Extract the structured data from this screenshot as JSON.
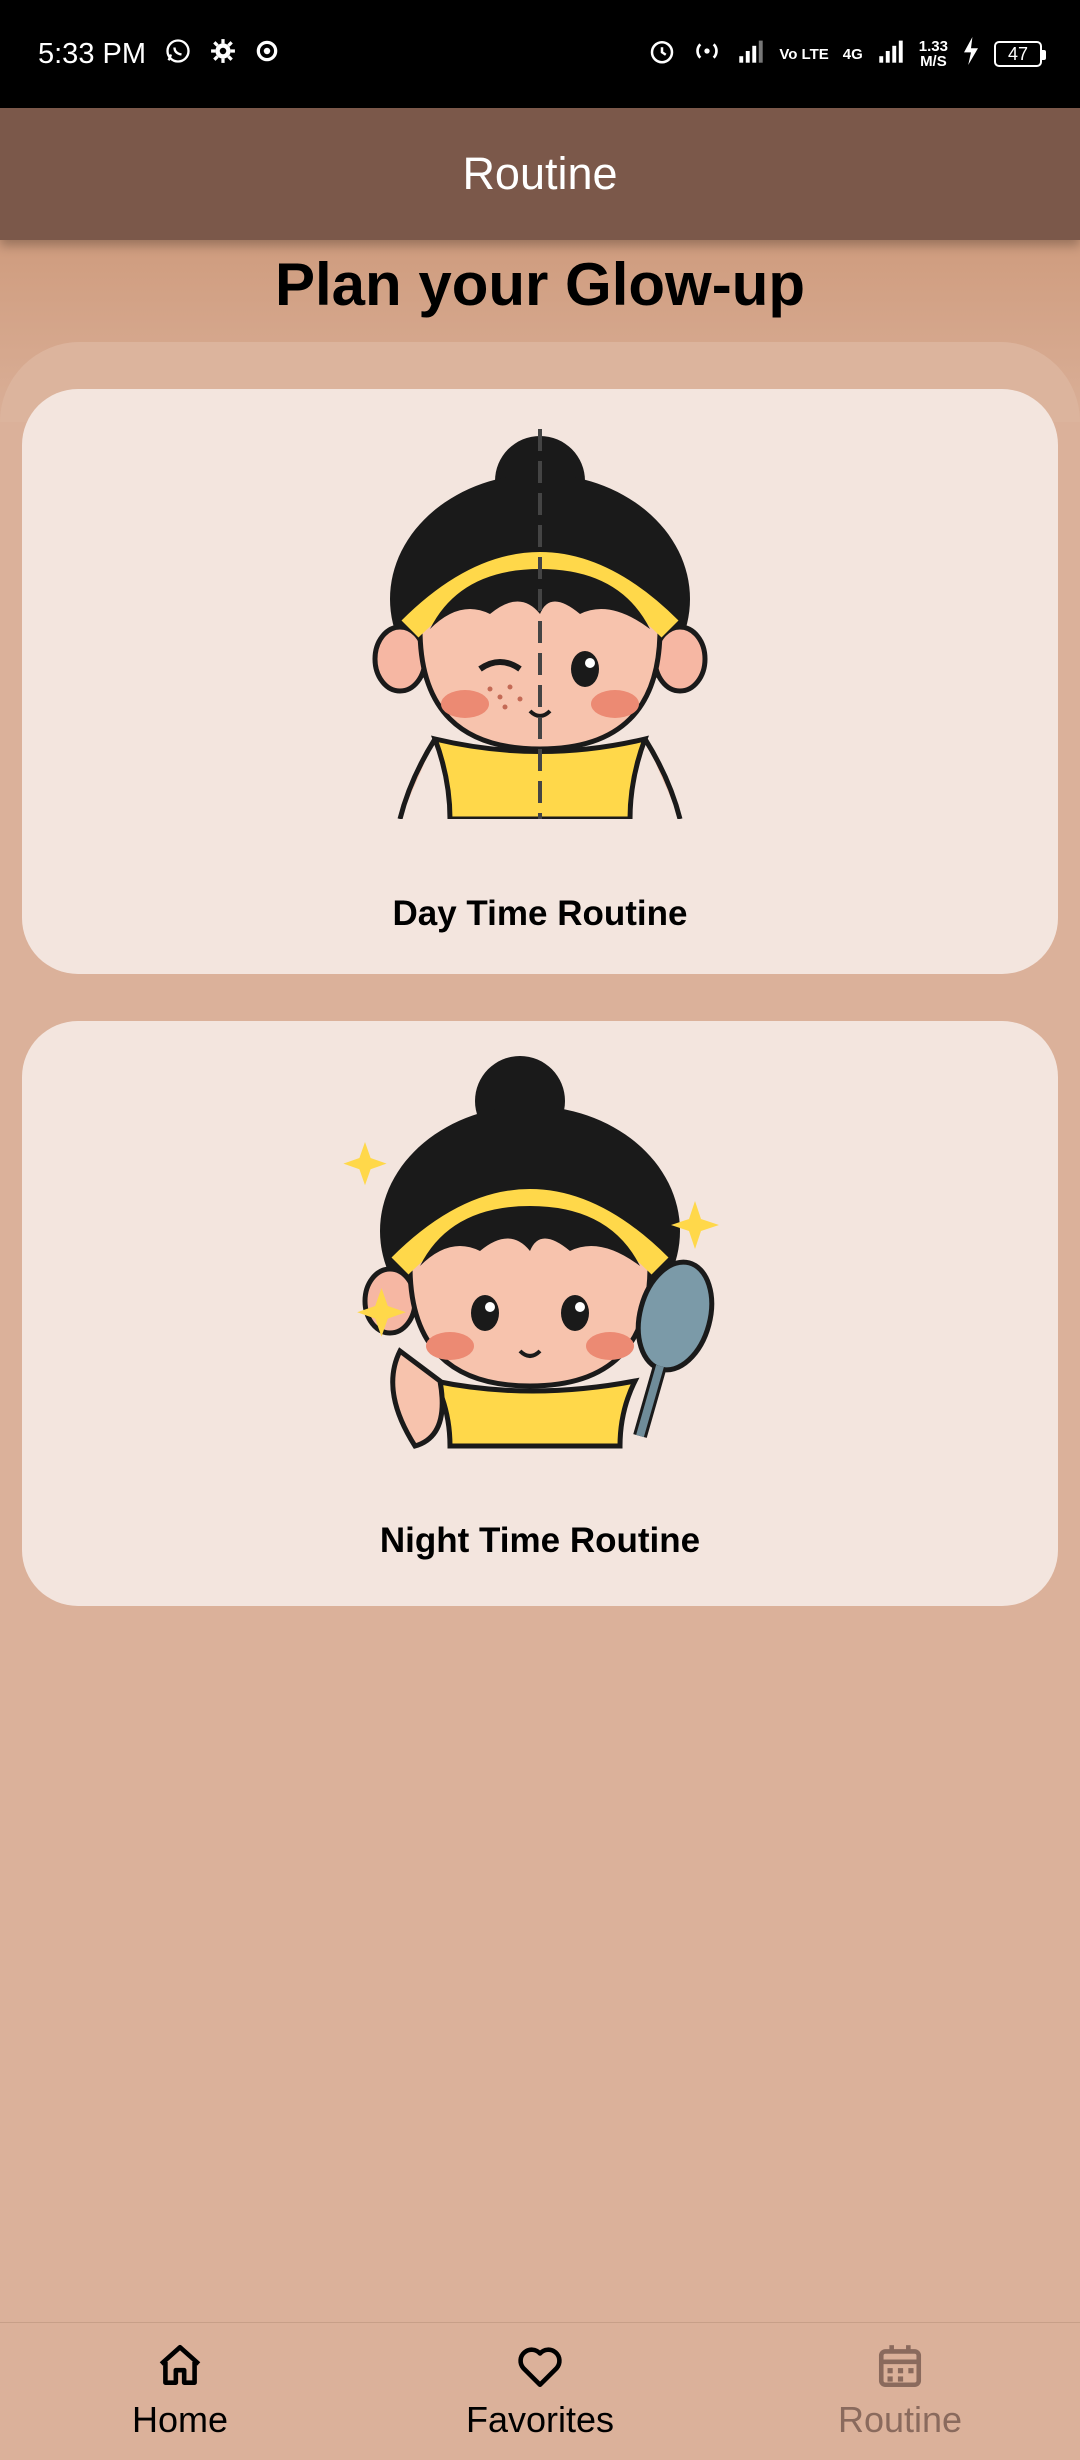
{
  "status_bar": {
    "time": "5:33 PM",
    "left_icons": [
      "whatsapp-icon",
      "gear-icon",
      "settings-icon"
    ],
    "right_icons": [
      "alarm-icon",
      "hotspot-icon",
      "signal-icon",
      "volte-icon",
      "signal-4g-icon",
      "charging-icon"
    ],
    "volte_label": "Vo LTE",
    "network_label": "4G",
    "data_speed": "1.33",
    "data_speed_unit": "M/S",
    "battery": "47"
  },
  "app_bar": {
    "title": "Routine"
  },
  "page": {
    "heading": "Plan your Glow-up"
  },
  "cards": [
    {
      "label": "Day Time Routine",
      "icon": "face-split-illustration"
    },
    {
      "label": "Night Time Routine",
      "icon": "face-mirror-illustration"
    }
  ],
  "bottom_nav": {
    "items": [
      {
        "label": "Home",
        "icon": "home-icon",
        "active": false
      },
      {
        "label": "Favorites",
        "icon": "heart-icon",
        "active": false
      },
      {
        "label": "Routine",
        "icon": "calendar-icon",
        "active": true
      }
    ]
  },
  "colors": {
    "status_bar": "#000000",
    "app_bar": "#7b584a",
    "background": "#dbb19a",
    "card": "#f3e5de",
    "active_nav": "#8a6a5d"
  }
}
